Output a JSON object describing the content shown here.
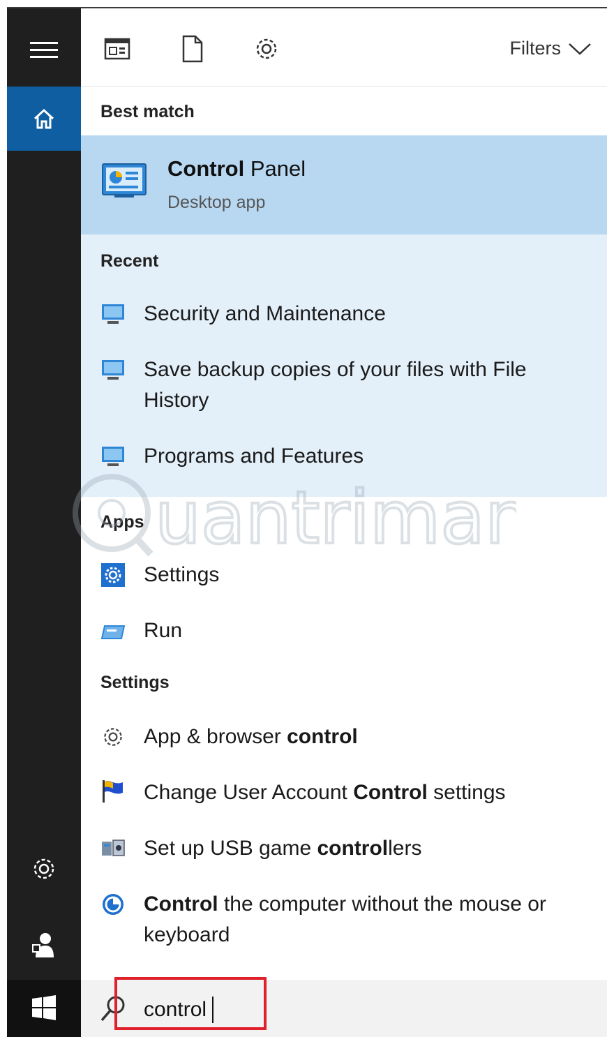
{
  "toolbar": {
    "filters_label": "Filters"
  },
  "best_match": {
    "heading": "Best match",
    "title_bold": "Control",
    "title_rest": " Panel",
    "subtitle": "Desktop app"
  },
  "recent": {
    "heading": "Recent",
    "items": [
      {
        "label": "Security and Maintenance"
      },
      {
        "label": "Save backup copies of your files with File History"
      },
      {
        "label": "Programs and Features"
      }
    ]
  },
  "apps": {
    "heading": "Apps",
    "items": [
      {
        "label": "Settings"
      },
      {
        "label": "Run"
      }
    ]
  },
  "settings": {
    "heading": "Settings",
    "items": [
      {
        "pre": "App & browser ",
        "bold": "control",
        "post": ""
      },
      {
        "pre": "Change User Account ",
        "bold": "Control",
        "post": " settings"
      },
      {
        "pre": "Set up USB game ",
        "bold": "control",
        "post": "lers"
      },
      {
        "pre": "",
        "bold": "Control",
        "post": " the computer without the mouse or keyboard"
      }
    ]
  },
  "search": {
    "value": "control"
  },
  "watermark": {
    "text": "uantrimang"
  },
  "colors": {
    "rail": "#1f1f1f",
    "home_active": "#0e5ea1",
    "best_match_bg": "#b8d8f2",
    "recent_bg": "#e3eff9",
    "highlight": "#e0202a"
  }
}
